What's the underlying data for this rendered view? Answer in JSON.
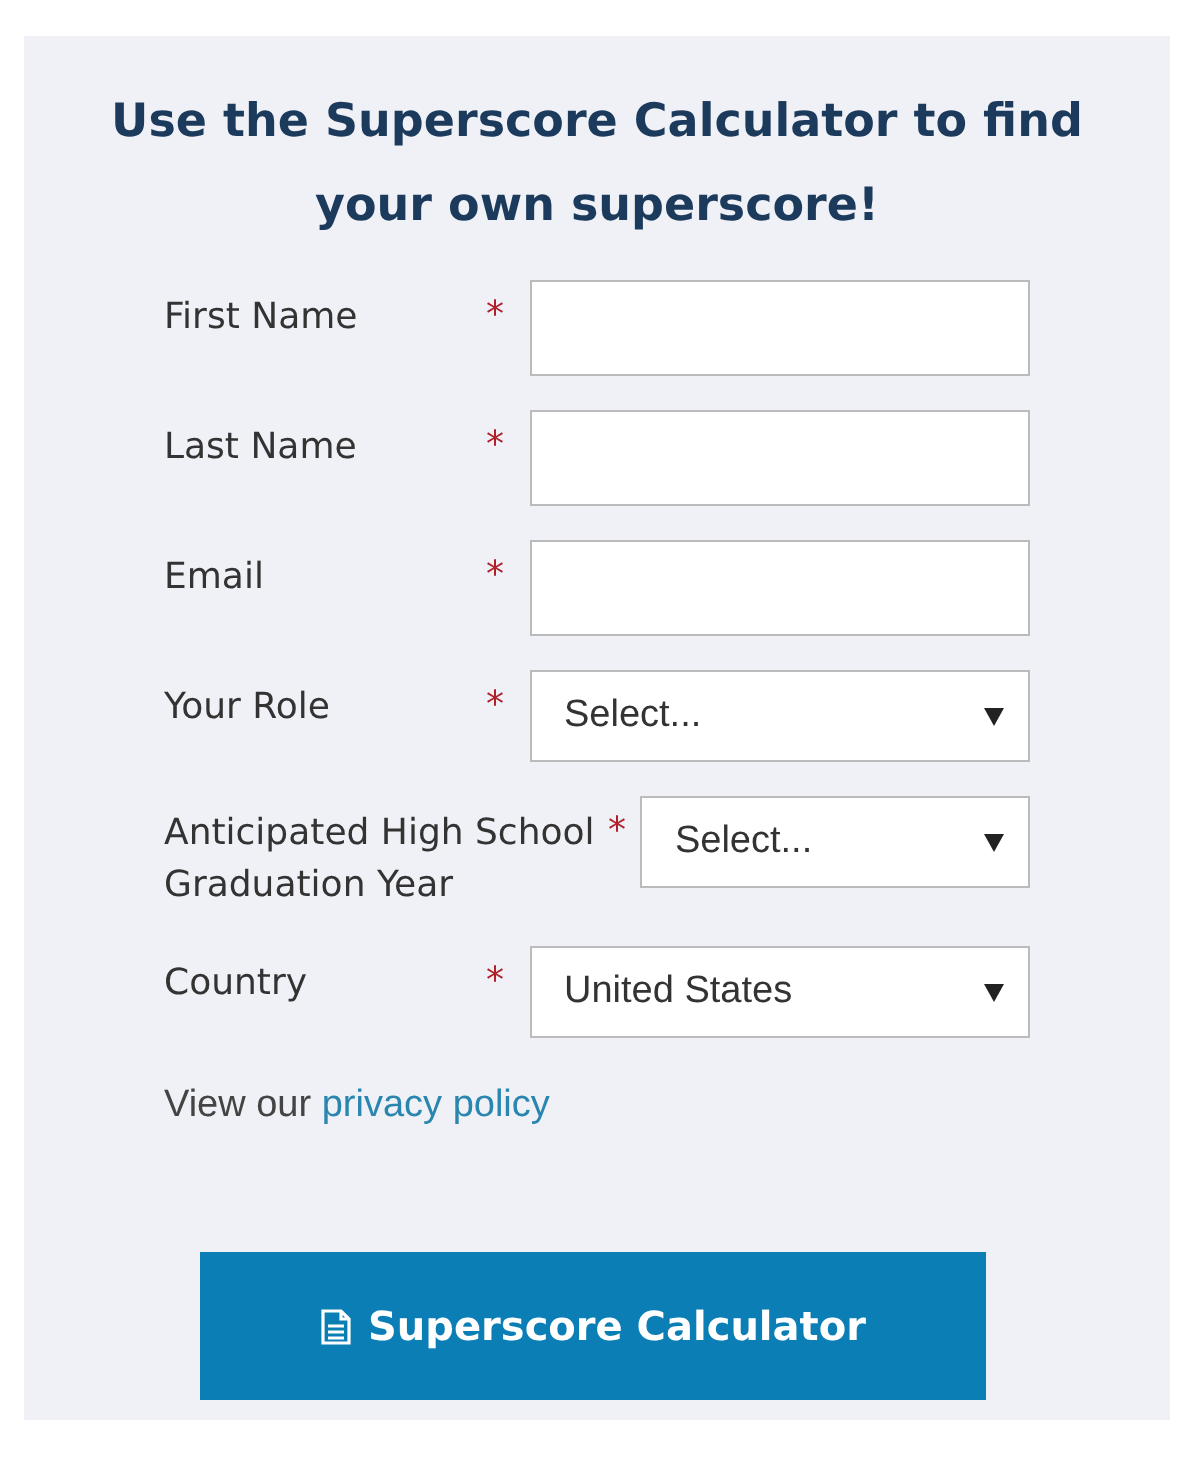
{
  "title": "Use the Superscore Calculator to find your own superscore!",
  "fields": [
    {
      "label": "First Name",
      "required_mark": "*",
      "kind": "text"
    },
    {
      "label": "Last Name",
      "required_mark": "*",
      "kind": "text"
    },
    {
      "label": "Email",
      "required_mark": "*",
      "kind": "text"
    },
    {
      "label": "Your Role",
      "required_mark": "*",
      "kind": "select",
      "value": "Select..."
    },
    {
      "label": "Anticipated High School Graduation Year",
      "required_mark": "*",
      "kind": "select",
      "value": "Select..."
    },
    {
      "label": "Country",
      "required_mark": "*",
      "kind": "select",
      "value": "United States"
    }
  ],
  "privacy": {
    "text": "View our",
    "link": "privacy policy"
  },
  "submit_button": "Superscore Calculator"
}
